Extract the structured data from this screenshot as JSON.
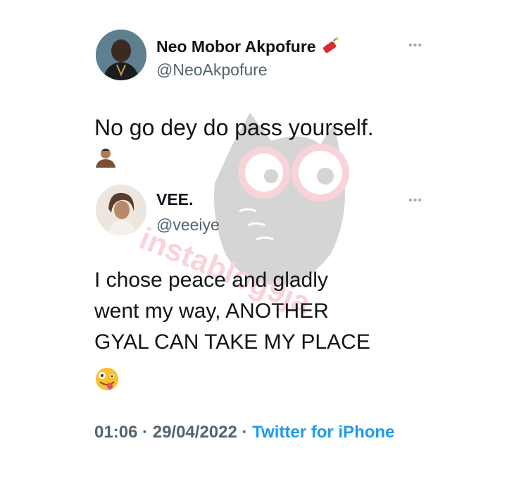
{
  "tweet": {
    "author_name": "Neo Mobor Akpofure",
    "author_handle": "@NeoAkpofure",
    "more_icon": "more-horizontal-icon",
    "text": "No go dey do pass yourself.",
    "emoji": "person-shrugging-emoji"
  },
  "quoted": {
    "author_name": "VEE.",
    "author_handle": "@veeiye",
    "more_icon": "more-horizontal-icon",
    "text_lines": [
      "I chose peace and gladly",
      "went my way, ANOTHER",
      "GYAL CAN TAKE MY PLACE"
    ],
    "emoji": "zany-face-emoji"
  },
  "footer": {
    "time": "01:06",
    "separator": " · ",
    "date": "29/04/2022",
    "source": "Twitter for iPhone"
  },
  "watermark": {
    "text": "instablog9ja",
    "color": "#f2a7b5"
  },
  "colors": {
    "text": "#0f1419",
    "secondary": "#536471",
    "link": "#1d9bf0"
  }
}
